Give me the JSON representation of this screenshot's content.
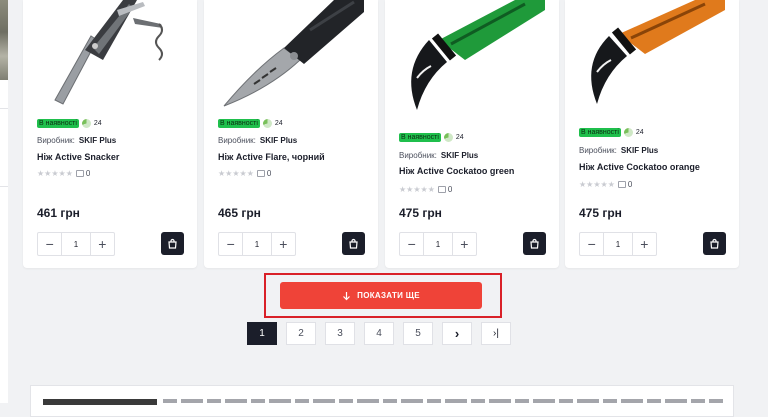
{
  "colors": {
    "page_bg": "#f1f2f4",
    "in_stock_badge": "#1fbf4c",
    "load_more_button": "#ef4338",
    "highlight_frame": "#d92028",
    "dark": "#1b1e2a"
  },
  "products": [
    {
      "stock_label": "В наявності",
      "qty": "24",
      "maker_label": "Виробник:",
      "maker": "SKIF Plus",
      "name": "Ніж Active Snacker",
      "reviews": "0",
      "price": "461 грн",
      "quantity": "1",
      "icons": [
        "minus-icon",
        "plus-icon",
        "shopping-bag-icon"
      ]
    },
    {
      "stock_label": "В наявності",
      "qty": "24",
      "maker_label": "Виробник:",
      "maker": "SKIF Plus",
      "name": "Ніж Active Flare, чорний",
      "reviews": "0",
      "price": "465 грн",
      "quantity": "1",
      "icons": [
        "minus-icon",
        "plus-icon",
        "shopping-bag-icon"
      ]
    },
    {
      "stock_label": "В наявності",
      "qty": "24",
      "maker_label": "Виробник:",
      "maker": "SKIF Plus",
      "name": "Ніж Active Cockatoo green",
      "reviews": "0",
      "price": "475 грн",
      "quantity": "1",
      "icons": [
        "minus-icon",
        "plus-icon",
        "shopping-bag-icon"
      ]
    },
    {
      "stock_label": "В наявності",
      "qty": "24",
      "maker_label": "Виробник:",
      "maker": "SKIF Plus",
      "name": "Ніж Active Cockatoo orange",
      "reviews": "0",
      "price": "475 грн",
      "quantity": "1",
      "icons": [
        "minus-icon",
        "plus-icon",
        "shopping-bag-icon"
      ]
    }
  ],
  "load_more": {
    "label": "ПОКАЗАТИ ЩЕ",
    "icon": "arrow-down-icon"
  },
  "pagination": {
    "pages": [
      "1",
      "2",
      "3",
      "4",
      "5"
    ],
    "current": "1",
    "next_symbol": "›",
    "last_symbol": "›|"
  }
}
